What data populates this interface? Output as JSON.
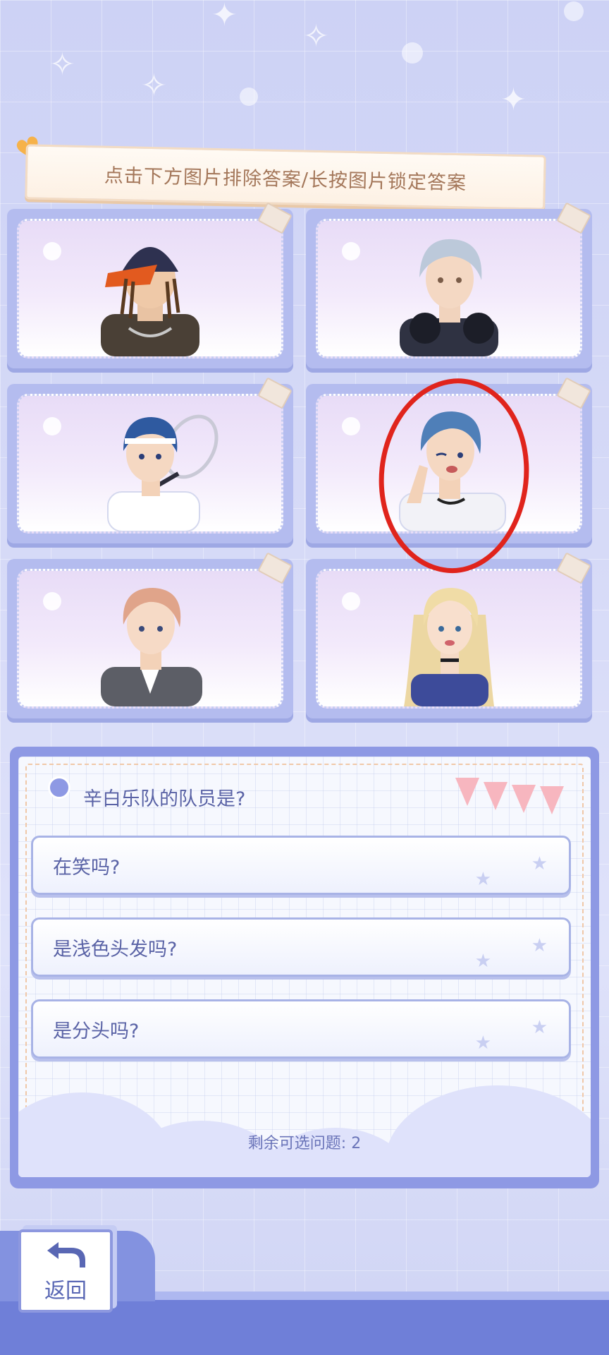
{
  "banner": {
    "instruction": "点击下方图片排除答案/长按图片锁定答案"
  },
  "cards": [
    {
      "id": "card-1",
      "portrait": "man-with-cap-and-dreadlocks",
      "highlighted": false
    },
    {
      "id": "card-2",
      "portrait": "silver-haired-man-with-headphones",
      "highlighted": false
    },
    {
      "id": "card-3",
      "portrait": "blue-haired-boy-with-tennis-racket",
      "highlighted": false
    },
    {
      "id": "card-4",
      "portrait": "blue-haired-man-winking",
      "highlighted": true
    },
    {
      "id": "card-5",
      "portrait": "pink-haired-man-in-suit",
      "highlighted": false
    },
    {
      "id": "card-6",
      "portrait": "blonde-woman-with-choker",
      "highlighted": false
    }
  ],
  "question": {
    "text": "辛白乐队的队员是?",
    "options": [
      {
        "label": "在笑吗?"
      },
      {
        "label": "是浅色头发吗?"
      },
      {
        "label": "是分头吗?"
      }
    ],
    "remaining": "剩余可选问题: 2"
  },
  "footer": {
    "back_label": "返回",
    "back_icon": "return-arrow-icon"
  },
  "colors": {
    "accent": "#8e99e4",
    "highlight_ring": "#e0241c",
    "text": "#5a63a6",
    "banner_text": "#a4775a"
  }
}
